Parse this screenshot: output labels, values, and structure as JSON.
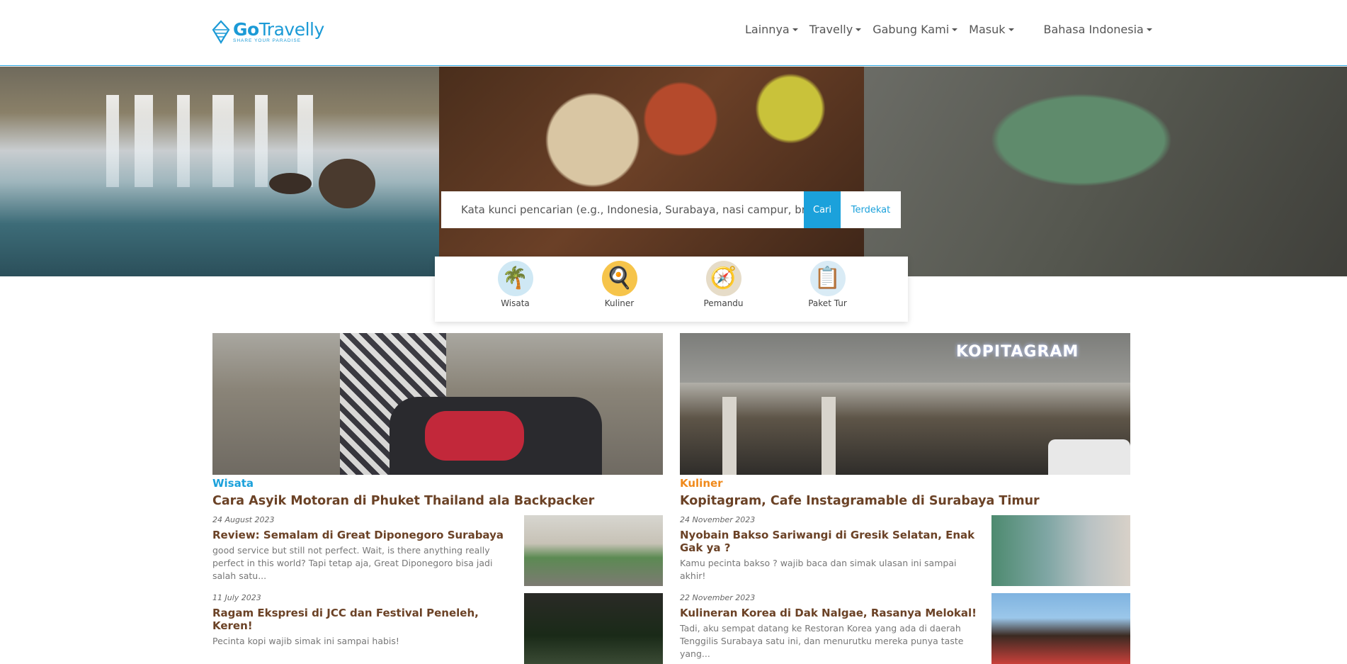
{
  "header": {
    "logo_name_bold": "Go",
    "logo_name_rest": "Travelly",
    "logo_tagline": "SHARE YOUR PARADISE",
    "nav": [
      {
        "label": "Lainnya"
      },
      {
        "label": "Travelly"
      },
      {
        "label": "Gabung Kami"
      },
      {
        "label": "Masuk"
      }
    ],
    "language": "Bahasa Indonesia"
  },
  "search": {
    "placeholder": "Kata kunci pencarian (e.g., Indonesia, Surabaya, nasi campur, bromo...)",
    "search_label": "Cari",
    "nearby_label": "Terdekat"
  },
  "categories": [
    {
      "label": "Wisata",
      "icon": "palm-tree-icon",
      "glyph": "🌴",
      "color": "#cfe8f4"
    },
    {
      "label": "Kuliner",
      "icon": "food-plate-icon",
      "glyph": "🍳",
      "color": "#f6c44a"
    },
    {
      "label": "Pemandu",
      "icon": "compass-icon",
      "glyph": "🧭",
      "color": "#e6dcc8"
    },
    {
      "label": "Paket Tur",
      "icon": "checklist-icon",
      "glyph": "📋",
      "color": "#d9ebf5"
    }
  ],
  "columns": {
    "left": {
      "feature": {
        "category": "Wisata",
        "title": "Cara Asyik Motoran di Phuket Thailand ala Backpacker"
      },
      "items": [
        {
          "date": "24 August 2023",
          "title": "Review: Semalam di Great Diponegoro Surabaya",
          "excerpt": "good service but still not perfect. Wait, is there anything really perfect in this world? Tapi tetap aja, Great Diponegoro bisa jadi salah satu..."
        },
        {
          "date": "11 July 2023",
          "title": "Ragam Ekspresi di JCC dan Festival Peneleh, Keren!",
          "excerpt": "Pecinta kopi wajib simak ini sampai habis!"
        }
      ]
    },
    "right": {
      "feature": {
        "category": "Kuliner",
        "title": "Kopitagram, Cafe Instagramable di Surabaya Timur",
        "sign_text": "KOPITAGRAM"
      },
      "items": [
        {
          "date": "24 November 2023",
          "title": "Nyobain Bakso Sariwangi di Gresik Selatan, Enak Gak ya ?",
          "excerpt": "Kamu pecinta bakso ? wajib baca dan simak ulasan ini sampai akhir!"
        },
        {
          "date": "22 November 2023",
          "title": "Kulineran Korea di Dak Nalgae, Rasanya Melokal!",
          "excerpt": "Tadi, aku sempat datang ke Restoran Korea yang ada di daerah Tenggilis Surabaya satu ini, dan menurutku mereka punya taste yang..."
        }
      ]
    }
  }
}
